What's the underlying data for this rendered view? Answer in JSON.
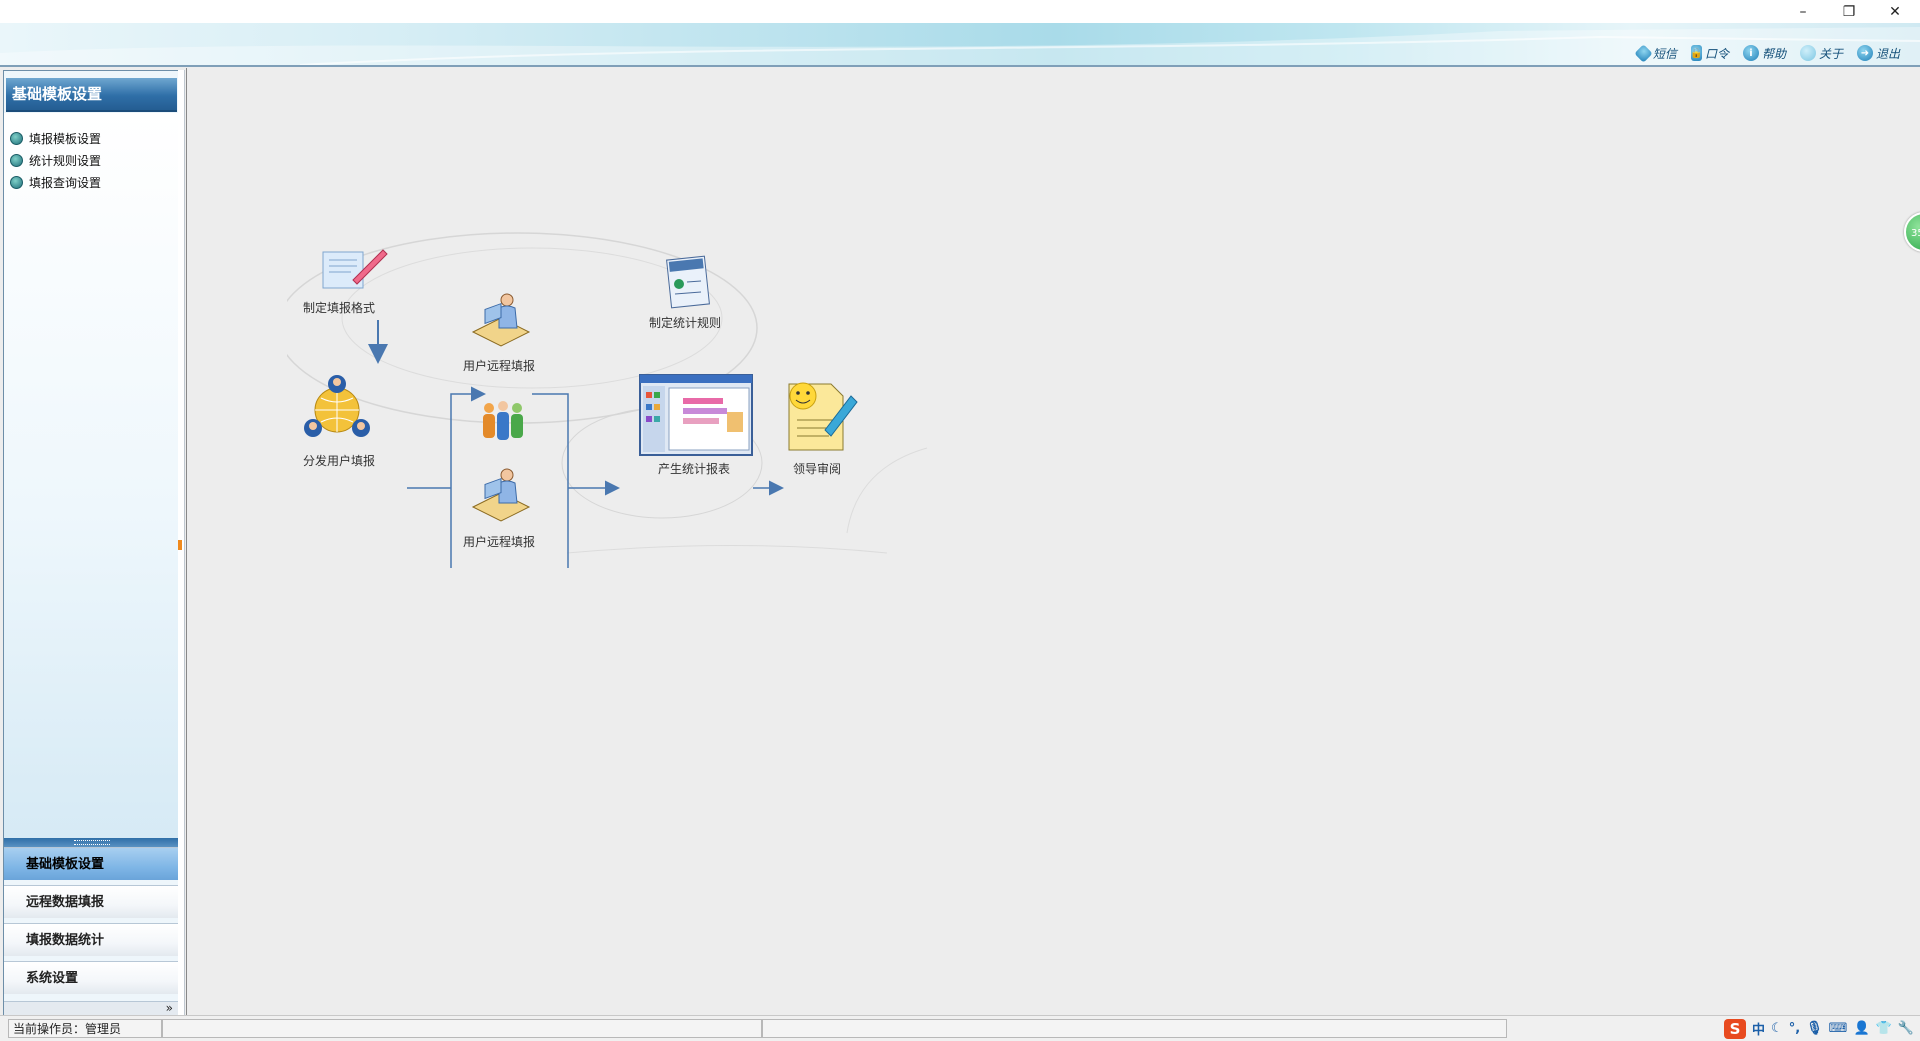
{
  "window": {
    "minimize_glyph": "–",
    "restore_glyph": "❐",
    "close_glyph": "✕"
  },
  "toplinks": [
    {
      "icon": "message-icon",
      "label": "短信"
    },
    {
      "icon": "lock-icon",
      "label": "口令"
    },
    {
      "icon": "help-icon",
      "label": "帮助"
    },
    {
      "icon": "about-icon",
      "label": "关于"
    },
    {
      "icon": "exit-icon",
      "label": "退出"
    }
  ],
  "sidebar": {
    "title": "基础模板设置",
    "items": [
      {
        "label": "填报模板设置"
      },
      {
        "label": "统计规则设置"
      },
      {
        "label": "填报查询设置"
      }
    ],
    "nav": [
      {
        "label": "基础模板设置",
        "active": true
      },
      {
        "label": "远程数据填报",
        "active": false
      },
      {
        "label": "填报数据统计",
        "active": false
      },
      {
        "label": "系统设置",
        "active": false
      }
    ],
    "expand_glyph": "»"
  },
  "flow": {
    "define_format": "制定填报格式",
    "distribute": "分发用户填报",
    "user_remote_top": "用户远程填报",
    "user_remote_bottom": "用户远程填报",
    "define_rules": "制定统计规则",
    "generate_report": "产生统计报表",
    "leader_review": "领导审阅"
  },
  "float_bubble": "35",
  "status": {
    "operator": "当前操作员：管理员"
  },
  "ime": {
    "logo": "S",
    "lang": "中",
    "icons": [
      "moon-icon",
      "punctuation-icon",
      "mic-icon",
      "keyboard-icon",
      "person-icon",
      "shirt-icon",
      "wrench-icon"
    ]
  },
  "colors": {
    "accent_blue": "#2f6fa8",
    "nav_active": "#7fb6e6",
    "arrow": "#4a78b0"
  }
}
